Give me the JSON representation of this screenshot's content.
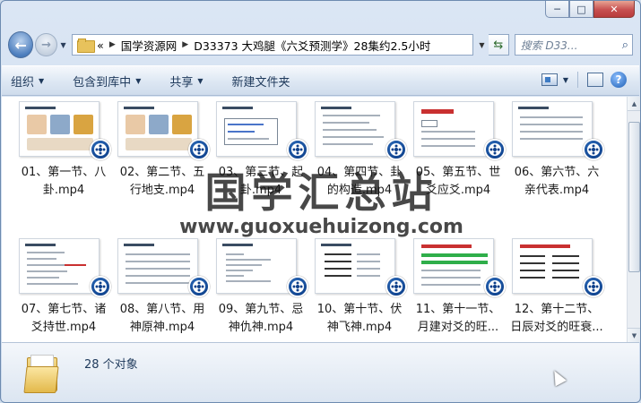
{
  "window": {
    "caption_minimize": "─",
    "caption_maximize": "□",
    "caption_close": "✕"
  },
  "nav": {
    "back_icon": "back-arrow-icon",
    "forward_icon": "forward-arrow-icon"
  },
  "address": {
    "overflow": "«",
    "crumbs": [
      "国学资源网",
      "D33373 大鸡腿《六爻预测学》28集约2.5小时"
    ]
  },
  "search": {
    "placeholder": "搜索 D33..."
  },
  "toolbar": {
    "organize": "组织",
    "include_library": "包含到库中",
    "share": "共享",
    "new_folder": "新建文件夹"
  },
  "files": [
    {
      "line1": "01、第一节、八",
      "line2": "卦.mp4",
      "thumb": "a"
    },
    {
      "line1": "02、第二节、五",
      "line2": "行地支.mp4",
      "thumb": "a"
    },
    {
      "line1": "03、第三节、起",
      "line2": "卦.mp4",
      "thumb": "b"
    },
    {
      "line1": "04、第四节、卦",
      "line2": "的构造.mp4",
      "thumb": "c"
    },
    {
      "line1": "05、第五节、世",
      "line2": "爻应爻.mp4",
      "thumb": "d"
    },
    {
      "line1": "06、第六节、六",
      "line2": "亲代表.mp4",
      "thumb": "e"
    },
    {
      "line1": "07、第七节、诸",
      "line2": "爻持世.mp4",
      "thumb": "f"
    },
    {
      "line1": "08、第八节、用",
      "line2": "神原神.mp4",
      "thumb": "g"
    },
    {
      "line1": "09、第九节、忌",
      "line2": "神仇神.mp4",
      "thumb": "h"
    },
    {
      "line1": "10、第十节、伏",
      "line2": "神飞神.mp4",
      "thumb": "i"
    },
    {
      "line1": "11、第十一节、",
      "line2": "月建对爻的旺...",
      "thumb": "j"
    },
    {
      "line1": "12、第十二节、",
      "line2": "日辰对爻的旺衰...",
      "thumb": "k"
    }
  ],
  "watermark": {
    "title": "国学汇总站",
    "url": "www.guoxuehuizong.com"
  },
  "details": {
    "count": "28 个对象"
  },
  "colors": {
    "accent": "#1e395b",
    "player_blue": "#0d3f8a",
    "close_red": "#c75050"
  }
}
